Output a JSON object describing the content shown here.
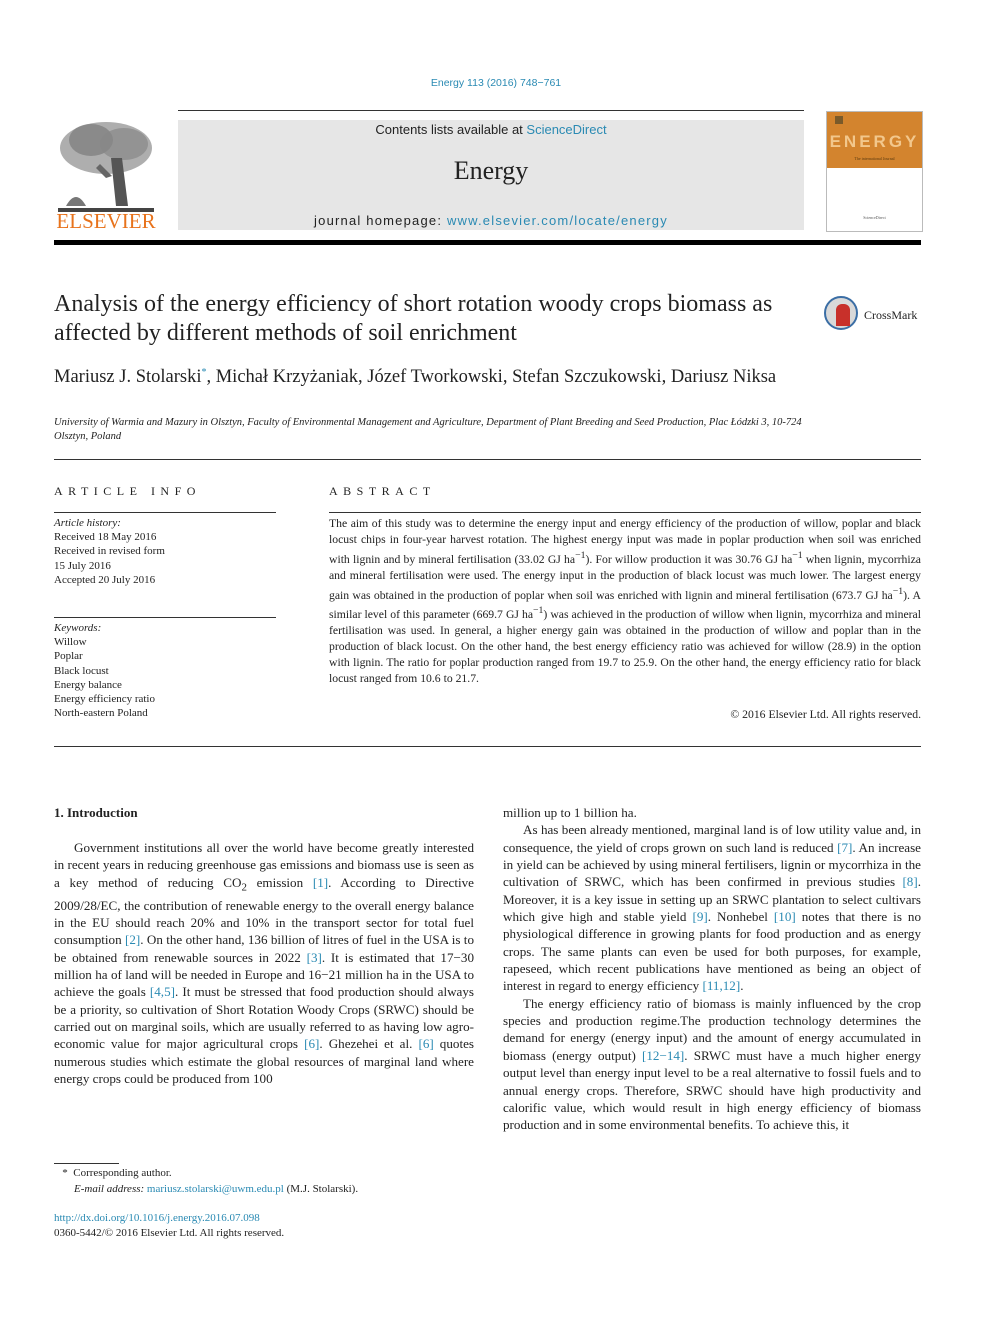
{
  "header": {
    "citation": "Energy 113 (2016) 748−761",
    "publisher_logo": "ELSEVIER",
    "contents_prefix": "Contents lists available at ",
    "contents_link": "ScienceDirect",
    "journal_name": "Energy",
    "homepage_prefix": "journal homepage: ",
    "homepage_link": "www.elsevier.com/locate/energy",
    "cover_title": "ENERGY",
    "cover_subtitle": "The international Journal",
    "cover_publisher": "ScienceDirect"
  },
  "article": {
    "title": "Analysis of the energy efficiency of short rotation woody crops biomass as affected by different methods of soil enrichment",
    "crossmark_label": "CrossMark",
    "authors": {
      "first": "Mariusz J. Stolarski",
      "first_mark": "*",
      "rest": ", Michał Krzyżaniak, Józef Tworkowski, Stefan Szczukowski, Dariusz Niksa"
    },
    "affiliation": "University of Warmia and Mazury in Olsztyn, Faculty of Environmental Management and Agriculture, Department of Plant Breeding and Seed Production, Plac Łódzki 3, 10-724 Olsztyn, Poland"
  },
  "article_info": {
    "heading": "ARTICLE INFO",
    "history_label": "Article history:",
    "history": [
      "Received 18 May 2016",
      "Received in revised form",
      "15 July 2016",
      "Accepted 20 July 2016"
    ],
    "keywords_label": "Keywords:",
    "keywords": [
      "Willow",
      "Poplar",
      "Black locust",
      "Energy balance",
      "Energy efficiency ratio",
      "North-eastern Poland"
    ]
  },
  "abstract": {
    "heading": "ABSTRACT",
    "parts": [
      "The aim of this study was to determine the energy input and energy efficiency of the production of willow, poplar and black locust chips in four-year harvest rotation. The highest energy input was made in poplar production when soil was enriched with lignin and by mineral fertilisation (33.02 GJ ha",
      "). For willow production it was 30.76 GJ ha",
      " when lignin, mycorrhiza and mineral fertilisation were used. The energy input in the production of black locust was much lower. The largest energy gain was obtained in the production of poplar when soil was enriched with lignin and mineral fertilisation (673.7 GJ ha",
      "). A similar level of this parameter (669.7 GJ ha",
      ") was achieved in the production of willow when lignin, mycorrhiza and mineral fertilisation was used. In general, a higher energy gain was obtained in the production of willow and poplar than in the production of black locust. On the other hand, the best energy efficiency ratio was achieved for willow (28.9) in the option with lignin. The ratio for poplar production ranged from 19.7 to 25.9. On the other hand, the energy efficiency ratio for black locust ranged from 10.6 to 21.7."
    ],
    "superscript": "−1",
    "copyright": "© 2016 Elsevier Ltd. All rights reserved."
  },
  "introduction": {
    "heading": "1.  Introduction",
    "left": {
      "p1": [
        "Government institutions all over the world have become greatly interested in recent years in reducing greenhouse gas emissions and biomass use is seen as a key method of reducing CO",
        "2",
        " emission ",
        "[1]",
        ". According to Directive 2009/28/EC, the contribution of renewable energy to the overall energy balance in the EU should reach 20% and 10% in the transport sector for total fuel consumption ",
        "[2]",
        ". On the other hand, 136 billion of litres of fuel in the USA is to be obtained from renewable sources in 2022 ",
        "[3]",
        ". It is estimated that 17−30 million ha of land will be needed in Europe and 16−21 million ha in the USA to achieve the goals ",
        "[4,5]",
        ". It must be stressed that food production should always be a priority, so cultivation of Short Rotation Woody Crops (SRWC) should be carried out on marginal soils, which are usually referred to as having low agro-economic value for major agricultural crops ",
        "[6]",
        ". Ghezehei et al. ",
        "[6]",
        " quotes numerous studies which estimate the global resources of marginal land where energy crops could be produced from 100"
      ]
    },
    "right": {
      "p0": "million up to 1 billion ha.",
      "p2": [
        "As has been already mentioned, marginal land is of low utility value and, in consequence, the yield of crops grown on such land is reduced ",
        "[7]",
        ". An increase in yield can be achieved by using mineral fertilisers, lignin or mycorrhiza in the cultivation of SRWC, which has been confirmed in previous studies ",
        "[8]",
        ". Moreover, it is a key issue in setting up an SRWC plantation to select cultivars which give high and stable yield ",
        "[9]",
        ". Nonhebel ",
        "[10]",
        " notes that there is no physiological difference in growing plants for food production and as energy crops. The same plants can even be used for both purposes, for example, rapeseed, which recent publications have mentioned as being an object of interest in regard to energy efficiency ",
        "[11,12]",
        "."
      ],
      "p3": [
        "The energy efficiency ratio of biomass is mainly influenced by the crop species and production regime.The production technology determines the demand for energy (energy input) and the amount of energy accumulated in biomass (energy output) ",
        "[12−14]",
        ". SRWC must have a much higher energy output level than energy input level to be a real alternative to fossil fuels and to annual energy crops. Therefore, SRWC should have high productivity and calorific value, which would result in high energy efficiency of biomass production and in some environmental benefits. To achieve this, it"
      ]
    }
  },
  "footer": {
    "corresponding_mark": "*",
    "corresponding_text": "Corresponding author.",
    "email_label": "E-mail address:",
    "email": "mariusz.stolarski@uwm.edu.pl",
    "email_owner": "(M.J. Stolarski).",
    "doi": "http://dx.doi.org/10.1016/j.energy.2016.07.098",
    "issn": "0360-5442/© 2016 Elsevier Ltd. All rights reserved."
  },
  "colors": {
    "link": "#2a8ab3",
    "elsevier_orange": "#e8731c",
    "masthead_gray": "#e6e6e6",
    "cover_orange": "#d3842e"
  }
}
